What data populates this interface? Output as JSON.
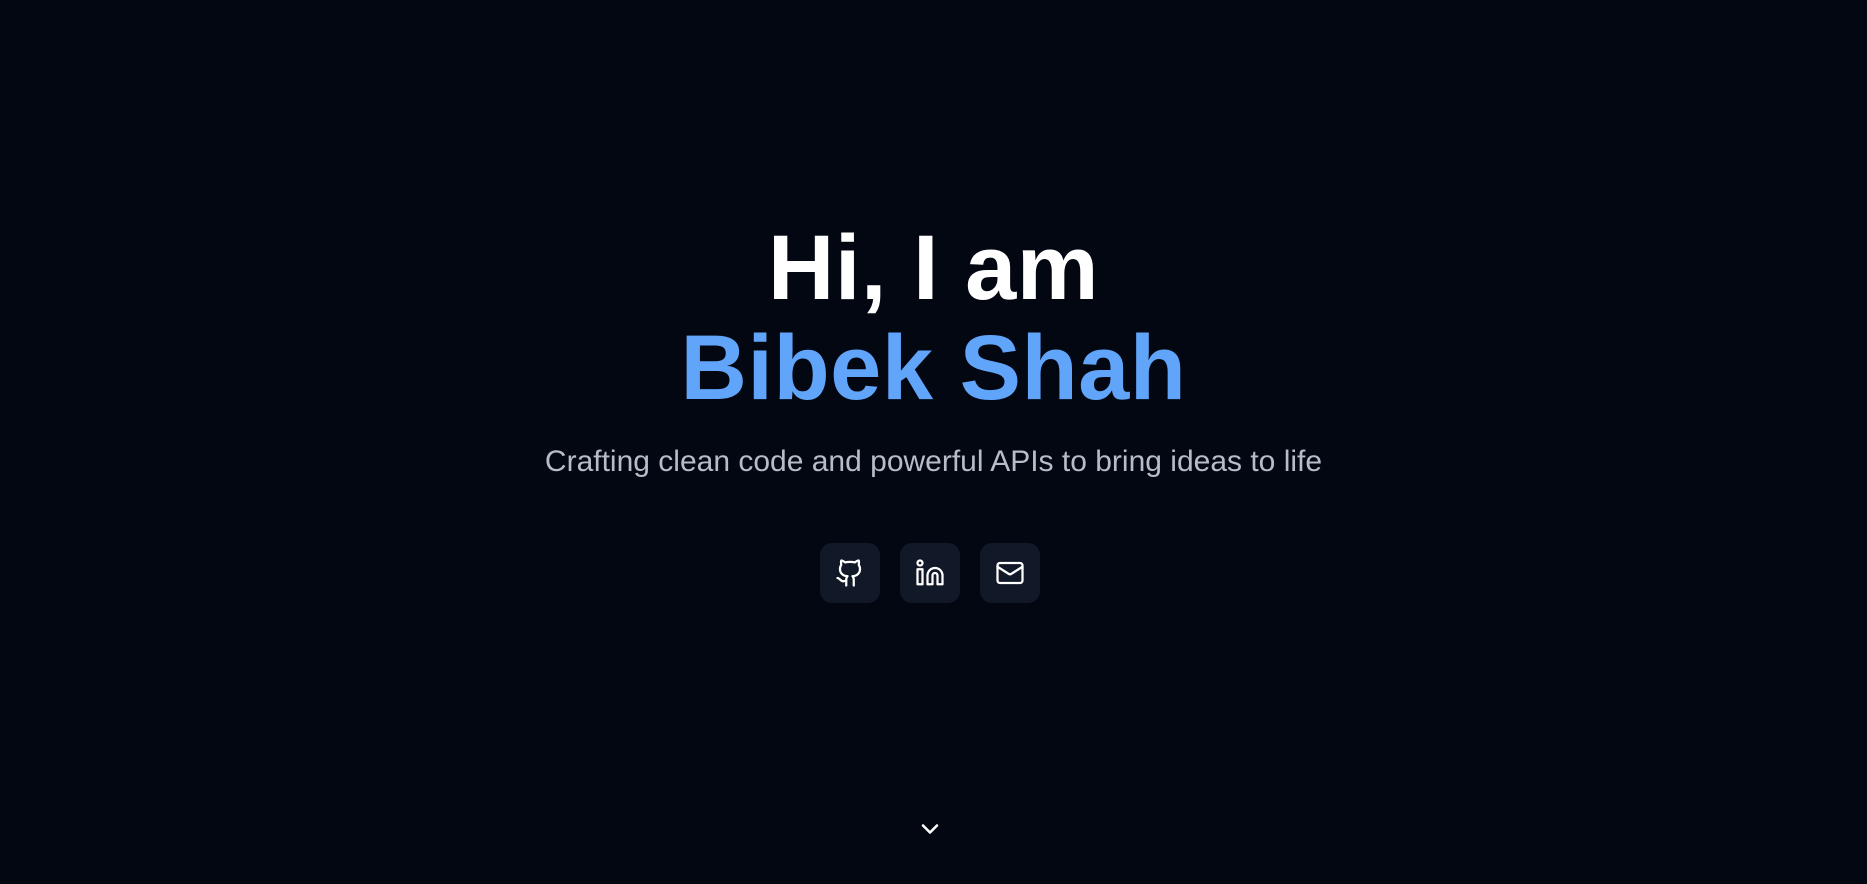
{
  "hero": {
    "greeting": "Hi, I am",
    "name": "Bibek Shah",
    "tagline": "Crafting clean code and powerful APIs to bring ideas to life"
  },
  "socials": [
    {
      "icon": "github-icon",
      "label": "GitHub"
    },
    {
      "icon": "linkedin-icon",
      "label": "LinkedIn"
    },
    {
      "icon": "mail-icon",
      "label": "Email"
    }
  ],
  "scroll": {
    "icon": "chevron-down-icon"
  },
  "colors": {
    "background": "#030712",
    "accent": "#60a5fa",
    "heading": "#ffffff",
    "muted_text": "#b6bdc8",
    "icon_button_bg": "#111827"
  }
}
